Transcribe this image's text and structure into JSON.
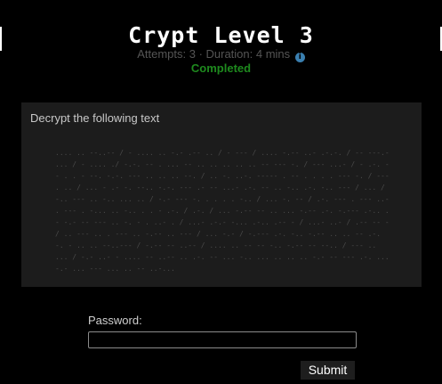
{
  "header": {
    "title": "Crypt Level 3",
    "meta_text": "Attempts: 3 · Duration: 4 mins",
    "info_icon": "info-icon",
    "status": "Completed"
  },
  "panel": {
    "heading": "Decrypt the following text",
    "cipher_text": ".... .. --..-- / - .... .. -.- .-- .. / - --- / .... -.-- ..- .-.-. / -- ---.- ... / - .... ./ -.-. -- . ... -- .. .. .. .. .. -- --- -. / --- ...- / - .-. -- . . - --. -.-. --- .. .. .. --. / .. -. ..-. ----- . -- . . . . --- -. / --- . .. / ... - .- -. --.. -.-. --- .- -- ...- .-. -- .. -.. .-. -.. --- / ... / -.. --- .. -.. ... .. / -.- --- -. . . . . -.. / ... -. -- / .-. --- . --- ..- . --- . -... .. -.. . . - .-. / .-. / ... -.-- -- .. ... -.-- .-. -.--- .-.. .- -.- -- --- .. -. - . ..- . / ...- .-.- -... .-.. .-- - / ...- ..- / .-- -- - / .. --- .. . --- .. -.-- .. --- / ... -.- / -.--- .-. -.. -.-- .. .. -- .-. -. - .. .. --..--- / -.-- -- ..-- / .... .. -- -- -.. -.-- -- --.. / --- .. ... / -.- ..- - .... -- ..-- .. .-. -- ... -.. ... .. .. .. -.- -- --- .-. ... -.- ... --- ... .. -- ..-..."
  },
  "form": {
    "password_label": "Password:",
    "password_value": "",
    "submit_label": "Submit"
  }
}
